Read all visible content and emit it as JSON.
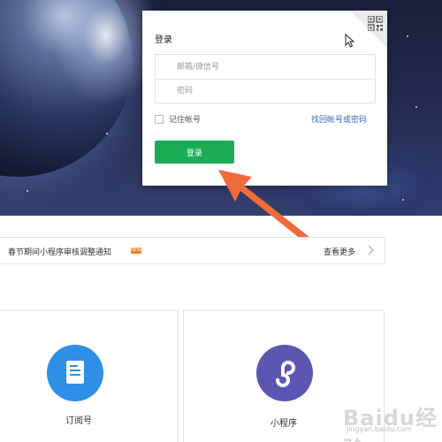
{
  "login": {
    "title": "登录",
    "username_placeholder": "邮箱/微信号",
    "password_placeholder": "密码",
    "remember_label": "记住帐号",
    "forgot_link": "找回帐号或密码",
    "submit_label": "登录"
  },
  "notice": {
    "text": "春节期间小程序审核调整通知",
    "badge": "NEW",
    "more_label": "查看更多"
  },
  "account_types": [
    {
      "label": "订阅号",
      "icon": "document-icon",
      "color": "#2f8ee6"
    },
    {
      "label": "小程序",
      "icon": "mini-program-icon",
      "color": "#5c56b3"
    }
  ],
  "watermark": {
    "brand": "Baidu经验",
    "url": "jingyan.baidu.com"
  },
  "colors": {
    "login_button": "#1aad56",
    "link": "#3b66b8",
    "annotation_arrow": "#f26b3a"
  }
}
